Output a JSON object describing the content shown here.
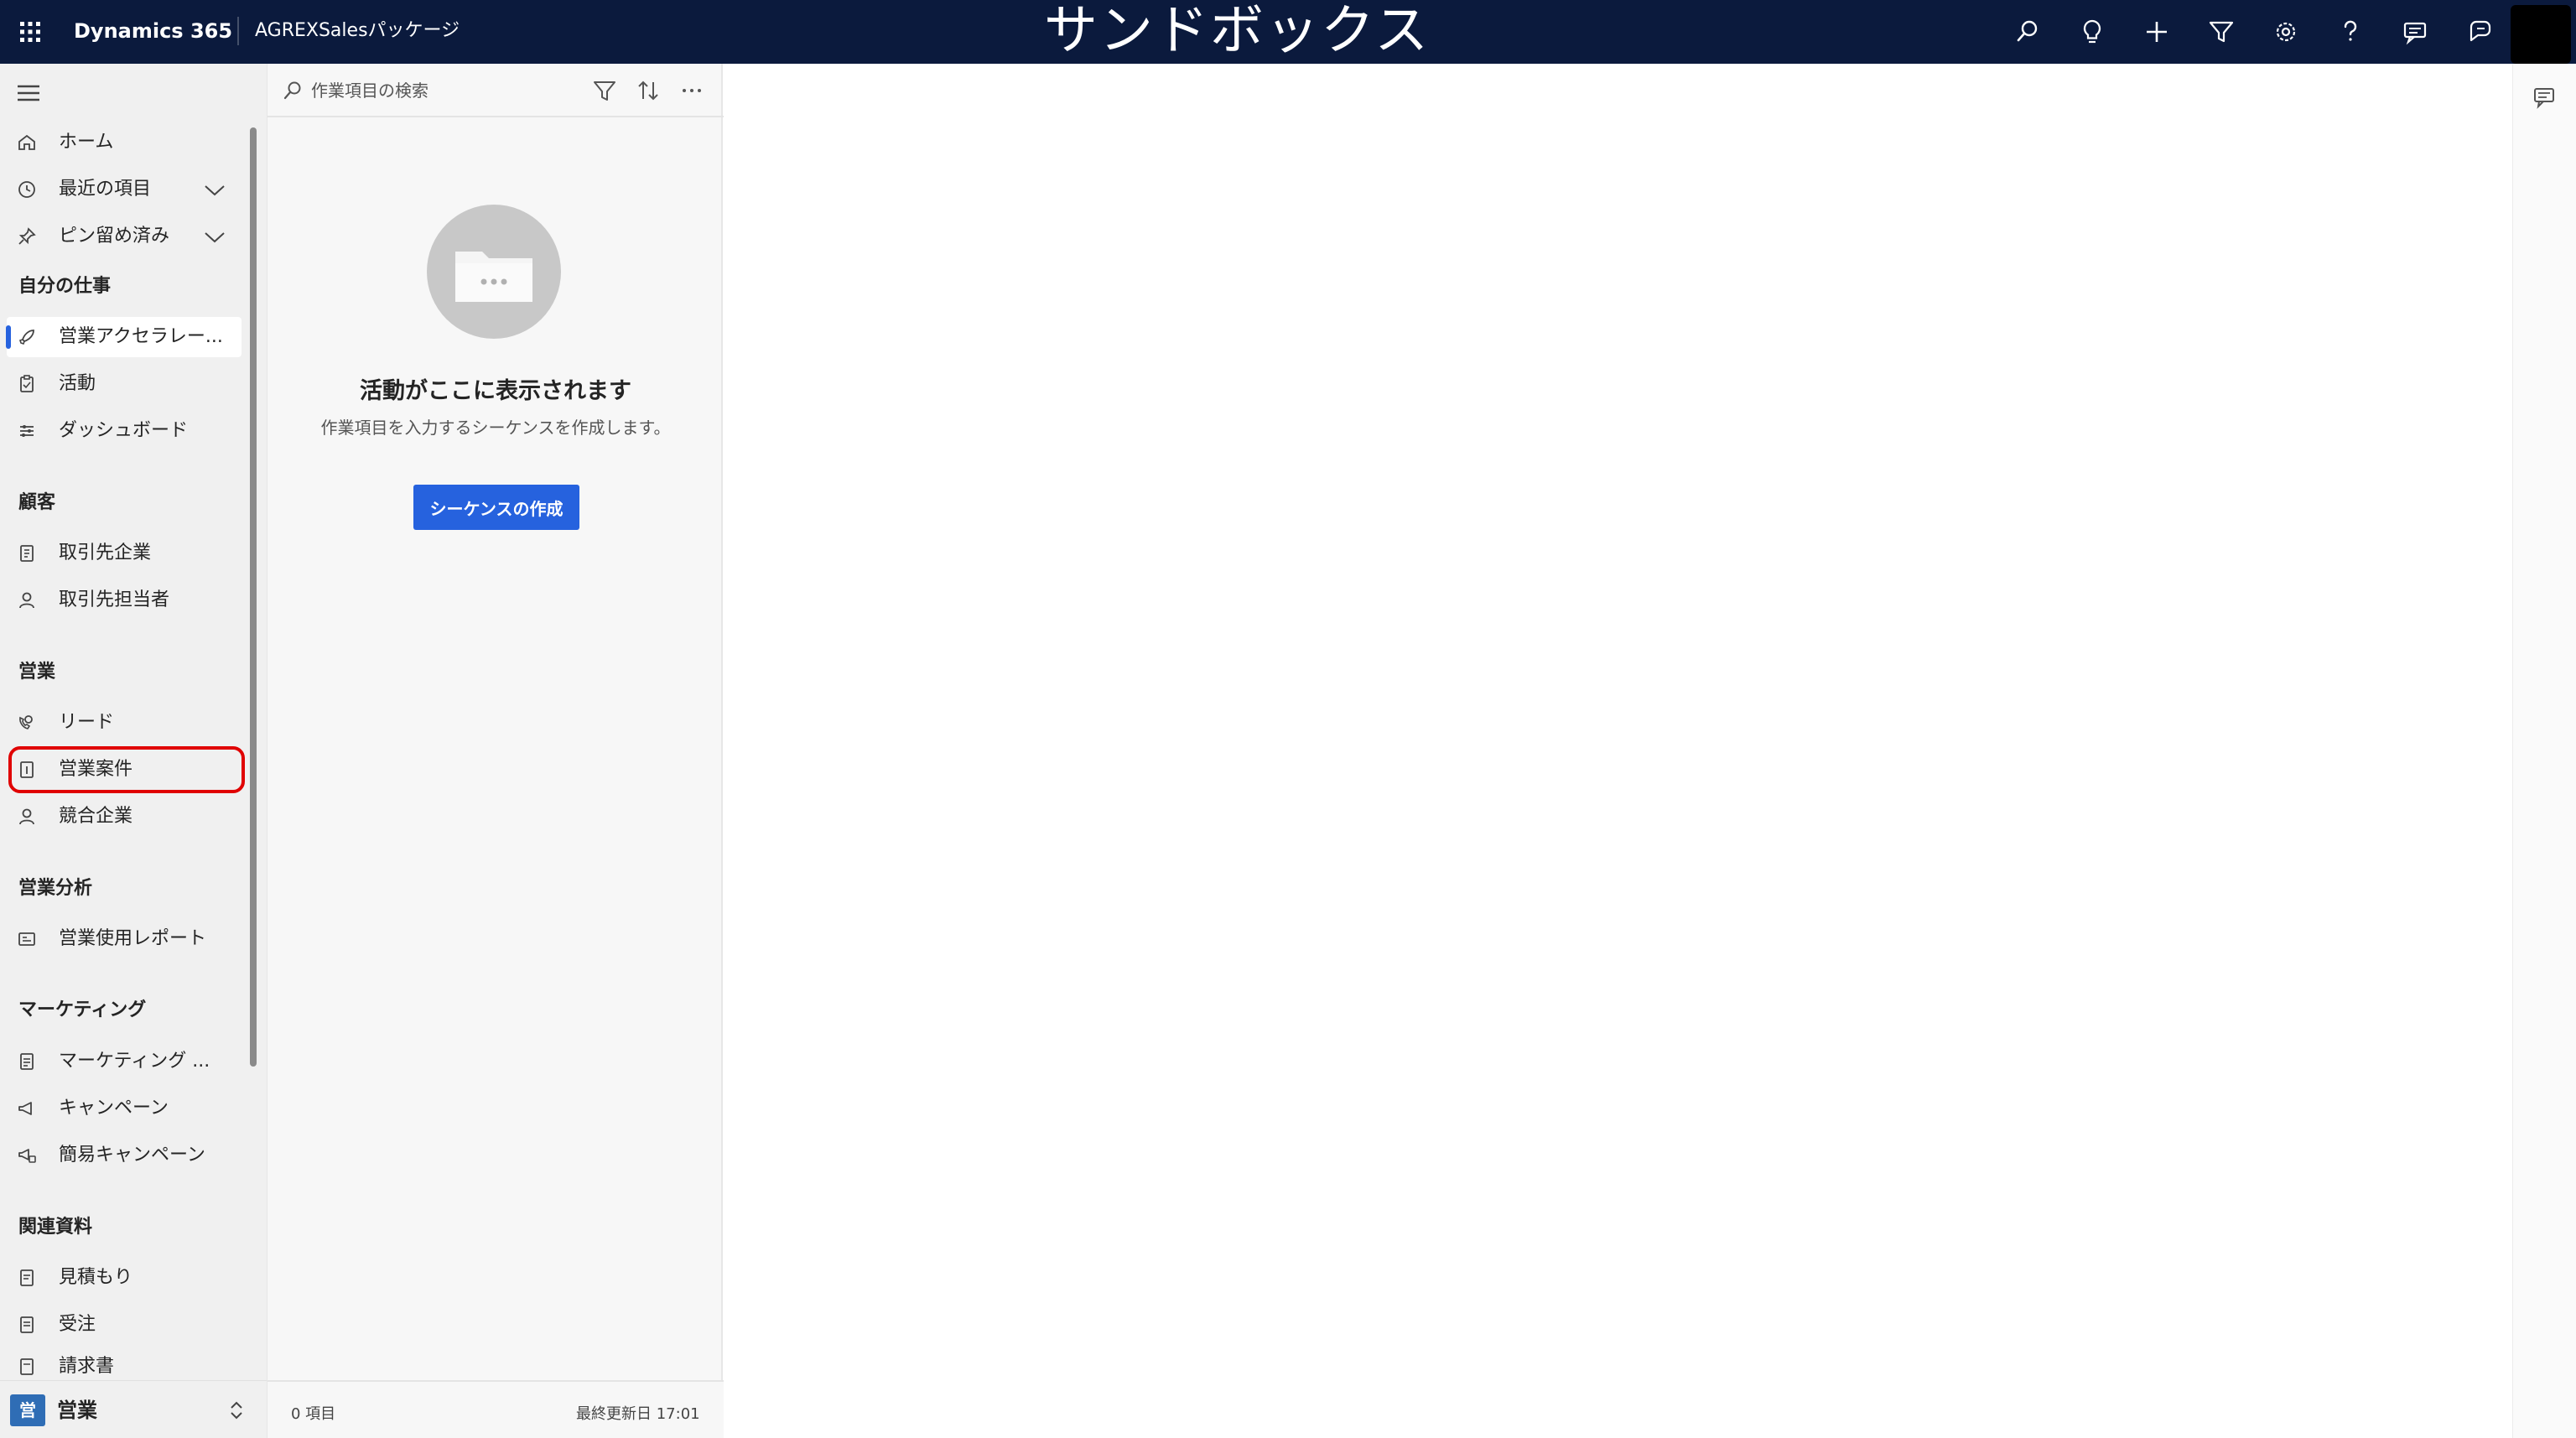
{
  "header": {
    "brand": "Dynamics 365",
    "app_name": "AGREXSalesパッケージ",
    "environment_title": "サンドボックス",
    "icons": [
      "waffle-icon",
      "search-icon",
      "lightbulb-icon",
      "plus-icon",
      "filter-icon",
      "settings-icon",
      "help-icon",
      "chat-icon",
      "copilot-icon"
    ],
    "colors": {
      "bar": "#0b1a3d",
      "accent": "#2662de",
      "highlight_outline": "#e00000"
    }
  },
  "sitemap": {
    "top_items": [
      {
        "label": "ホーム",
        "icon": "home-icon"
      },
      {
        "label": "最近の項目",
        "icon": "clock-icon"
      },
      {
        "label": "ピン留め済み",
        "icon": "pin-icon"
      }
    ],
    "sections": [
      {
        "title": "自分の仕事",
        "items": [
          {
            "label": "営業アクセラレー...",
            "icon": "rocket-icon"
          },
          {
            "label": "活動",
            "icon": "clipboard-icon"
          },
          {
            "label": "ダッシュボード",
            "icon": "dashboard-icon"
          }
        ]
      },
      {
        "title": "顧客",
        "items": [
          {
            "label": "取引先企業",
            "icon": "building-icon"
          },
          {
            "label": "取引先担当者",
            "icon": "person-icon"
          }
        ]
      },
      {
        "title": "営業",
        "items": [
          {
            "label": "リード",
            "icon": "phone-person-icon"
          },
          {
            "label": "営業案件",
            "icon": "document-icon"
          },
          {
            "label": "競合企業",
            "icon": "person-icon"
          }
        ]
      },
      {
        "title": "営業分析",
        "items": [
          {
            "label": "営業使用レポート",
            "icon": "report-icon"
          }
        ]
      },
      {
        "title": "マーケティング",
        "items": [
          {
            "label": "マーケティング ...",
            "icon": "list-icon"
          },
          {
            "label": "キャンペーン",
            "icon": "megaphone-icon"
          },
          {
            "label": "簡易キャンペーン",
            "icon": "quick-campaign-icon"
          }
        ]
      },
      {
        "title": "関連資料",
        "items": [
          {
            "label": "見積もり",
            "icon": "quote-icon"
          },
          {
            "label": "受注",
            "icon": "order-icon"
          },
          {
            "label": "請求書",
            "icon": "invoice-icon"
          }
        ]
      }
    ],
    "selected": "営業アクセラレー...",
    "highlighted": "営業案件",
    "area": {
      "badge": "営",
      "label": "営業"
    }
  },
  "worklist": {
    "search_placeholder": "作業項目の検索",
    "empty_title": "活動がここに表示されます",
    "empty_subtitle": "作業項目を入力するシーケンスを作成します。",
    "create_button": "シーケンスの作成",
    "item_count": "0 項目",
    "last_updated": "最終更新日 17:01"
  }
}
